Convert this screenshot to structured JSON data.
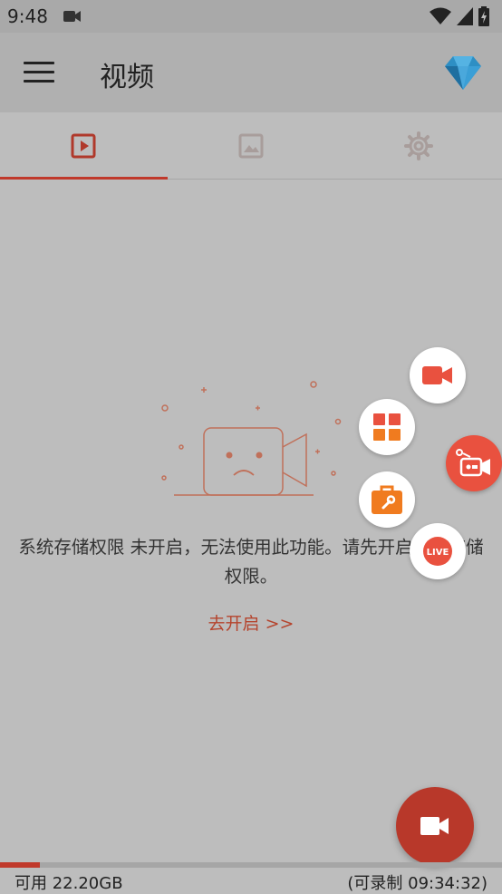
{
  "status_bar": {
    "time": "9:48"
  },
  "app_bar": {
    "title": "视频"
  },
  "tabs": [
    {
      "name": "videos",
      "icon": "video-play-icon",
      "active": true
    },
    {
      "name": "images",
      "icon": "image-icon",
      "active": false
    },
    {
      "name": "settings",
      "icon": "gear-icon",
      "active": false
    }
  ],
  "empty_state": {
    "message": "系统存储权限 未开启，无法使用此功能。请先开启系统存储权限。",
    "link": "去开启 >>"
  },
  "floating_menu": [
    {
      "name": "record-video",
      "icon": "video-camera-icon"
    },
    {
      "name": "tools",
      "icon": "grid-icon"
    },
    {
      "name": "toolbox",
      "icon": "toolbox-icon"
    },
    {
      "name": "live",
      "icon": "live-icon",
      "label": "LIVE"
    }
  ],
  "storage": {
    "free": "可用 22.20GB",
    "record_time": "(可录制 09:34:32)",
    "used_fraction": 0.08
  },
  "colors": {
    "accent": "#c0392b",
    "float": "#e9513f",
    "background": "#bdbdbd"
  }
}
